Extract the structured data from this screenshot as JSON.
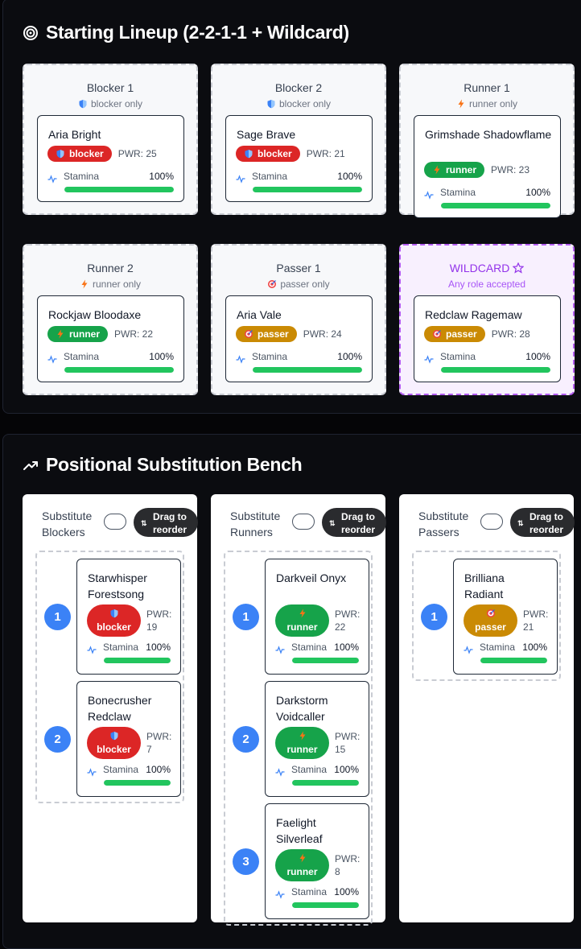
{
  "lineup": {
    "title": "Starting Lineup (2-2-1-1 + Wildcard)",
    "slots": [
      {
        "title": "Blocker 1",
        "sub": "blocker only",
        "sub_icon": "shield-icon",
        "player": {
          "name": "Aria Bright",
          "role": "blocker",
          "pwr": "PWR: 25",
          "stamina_label": "Stamina",
          "stamina": "100%"
        }
      },
      {
        "title": "Blocker 2",
        "sub": "blocker only",
        "sub_icon": "shield-icon",
        "player": {
          "name": "Sage Brave",
          "role": "blocker",
          "pwr": "PWR: 21",
          "stamina_label": "Stamina",
          "stamina": "100%"
        }
      },
      {
        "title": "Runner 1",
        "sub": "runner only",
        "sub_icon": "lightning-icon",
        "player": {
          "name": "Grimshade Shadowflame",
          "role": "runner",
          "pwr": "PWR: 23",
          "stamina_label": "Stamina",
          "stamina": "100%"
        }
      },
      {
        "title": "Runner 2",
        "sub": "runner only",
        "sub_icon": "lightning-icon",
        "player": {
          "name": "Rockjaw Bloodaxe",
          "role": "runner",
          "pwr": "PWR: 22",
          "stamina_label": "Stamina",
          "stamina": "100%"
        }
      },
      {
        "title": "Passer 1",
        "sub": "passer only",
        "sub_icon": "target-icon",
        "player": {
          "name": "Aria Vale",
          "role": "passer",
          "pwr": "PWR: 24",
          "stamina_label": "Stamina",
          "stamina": "100%"
        }
      },
      {
        "title": "WILDCARD",
        "sub": "Any role accepted",
        "sub_icon": "star-icon",
        "player": {
          "name": "Redclaw Ragemaw",
          "role": "passer",
          "pwr": "PWR: 28",
          "stamina_label": "Stamina",
          "stamina": "100%"
        }
      }
    ]
  },
  "bench": {
    "title": "Positional Substitution Bench",
    "drag_label": "Drag to reorder",
    "groups": [
      {
        "heading": "Substitute Blockers",
        "players": [
          {
            "num": "1",
            "name": "Starwhisper Forestsong",
            "role": "blocker",
            "pwr": "PWR: 19",
            "stamina_label": "Stamina",
            "stamina": "100%"
          },
          {
            "num": "2",
            "name": "Bonecrusher Redclaw",
            "role": "blocker",
            "pwr": "PWR: 7",
            "stamina_label": "Stamina",
            "stamina": "100%"
          }
        ]
      },
      {
        "heading": "Substitute Runners",
        "players": [
          {
            "num": "1",
            "name": "Darkveil Onyx",
            "role": "runner",
            "pwr": "PWR: 22",
            "stamina_label": "Stamina",
            "stamina": "100%"
          },
          {
            "num": "2",
            "name": "Darkstorm Voidcaller",
            "role": "runner",
            "pwr": "PWR: 15",
            "stamina_label": "Stamina",
            "stamina": "100%"
          },
          {
            "num": "3",
            "name": "Faelight Silverleaf",
            "role": "runner",
            "pwr": "PWR: 8",
            "stamina_label": "Stamina",
            "stamina": "100%"
          }
        ]
      },
      {
        "heading": "Substitute Passers",
        "players": [
          {
            "num": "1",
            "name": "Brilliana Radiant",
            "role": "passer",
            "pwr": "PWR: 21",
            "stamina_label": "Stamina",
            "stamina": "100%"
          }
        ]
      }
    ]
  },
  "colors": {
    "blocker": "#dc2626",
    "runner": "#16a34a",
    "passer": "#ca8a04",
    "wildcard": "#9333ea",
    "stamina": "#22c55e",
    "rank": "#3b82f6"
  }
}
